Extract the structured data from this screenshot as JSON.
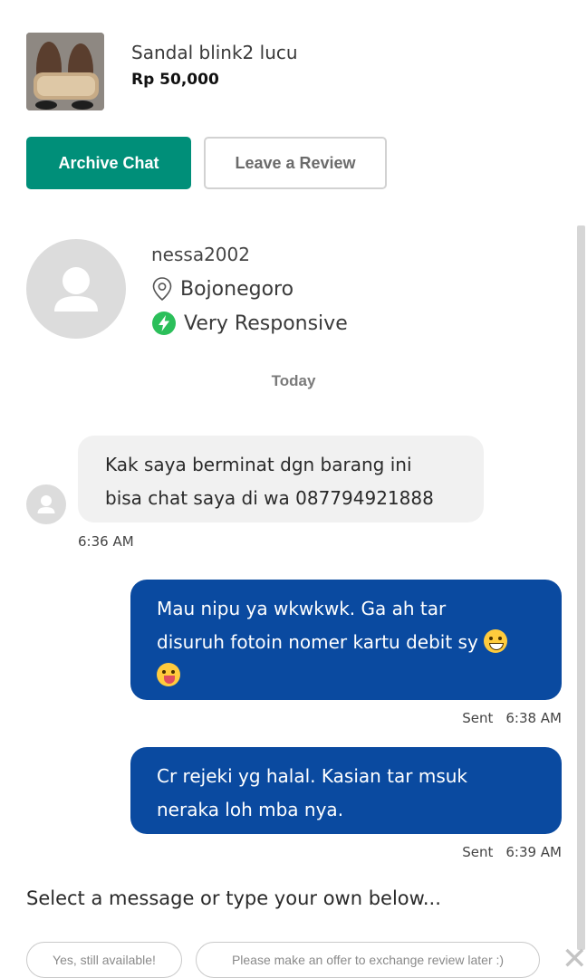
{
  "product": {
    "title": "Sandal blink2 lucu",
    "price": "Rp 50,000",
    "thumbnail_icon": "sandal-photo"
  },
  "actions": {
    "archive_label": "Archive Chat",
    "review_label": "Leave a Review"
  },
  "seller": {
    "username": "nessa2002",
    "location": "Bojonegoro",
    "responsiveness": "Very Responsive",
    "location_icon": "location-pin-icon",
    "responsive_icon": "lightning-bolt-icon"
  },
  "date_separator": "Today",
  "messages": [
    {
      "direction": "incoming",
      "lines": [
        "Kak saya berminat dgn barang ini",
        "bisa chat saya di wa 087794921888"
      ],
      "time": "6:36 AM"
    },
    {
      "direction": "outgoing",
      "lines": [
        "Mau nipu ya wkwkwk. Ga ah tar",
        "disuruh fotoin nomer kartu debit sy"
      ],
      "emojis": [
        "grinning-sweat-emoji",
        "winking-tongue-emoji"
      ],
      "status": "Sent",
      "time": "6:38 AM"
    },
    {
      "direction": "outgoing",
      "lines": [
        "Cr rejeki yg halal. Kasian tar msuk",
        "neraka loh mba nya."
      ],
      "status": "Sent",
      "time": "6:39 AM"
    }
  ],
  "quick_replies": {
    "prompt": "Select a message or type your own below...",
    "options": [
      "Yes, still available!",
      "Please make an offer to exchange review later :)"
    ]
  },
  "colors": {
    "accent_green": "#008f79",
    "outgoing_bubble": "#0a4aa0",
    "incoming_bubble": "#f1f1f1",
    "responsive_green": "#2bbf5a"
  }
}
